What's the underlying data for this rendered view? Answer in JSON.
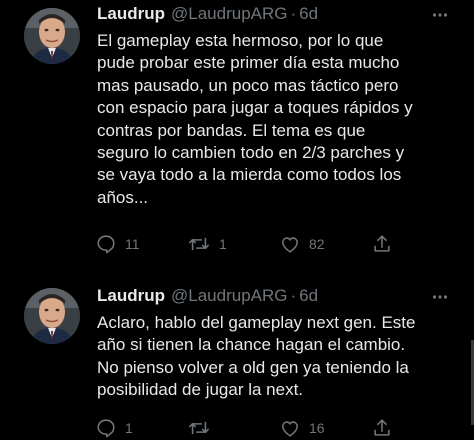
{
  "tweets": [
    {
      "author": {
        "name": "Laudrup",
        "handle": "@LaudrupARG",
        "separator": "·",
        "time": "6d"
      },
      "lines": [
        "El gameplay esta hermoso, por lo que",
        "pude probar este primer día esta mucho",
        "mas pausado, un poco mas táctico pero",
        "con espacio para jugar a toques rápidos y",
        "contras por bandas. El tema es que",
        "seguro lo cambien todo en 2/3 parches y",
        "se vaya todo a la mierda como todos los",
        "años..."
      ],
      "actions": {
        "replies": "11",
        "retweets": "1",
        "likes": "82"
      }
    },
    {
      "author": {
        "name": "Laudrup",
        "handle": "@LaudrupARG",
        "separator": "·",
        "time": "6d"
      },
      "lines": [
        "Aclaro, hablo del gameplay next gen. Este",
        "año si tienen la chance hagan el cambio.",
        "No pienso volver a old gen ya teniendo la",
        "posibilidad de jugar la next."
      ],
      "actions": {
        "replies": "1",
        "retweets": "",
        "likes": "16"
      }
    }
  ],
  "icons": {
    "reply": "reply-icon",
    "retweet": "retweet-icon",
    "like": "heart-icon",
    "share": "share-icon",
    "more": "more-icon"
  },
  "colors": {
    "background": "#000000",
    "text": "#e7e9ea",
    "secondary": "#71767b"
  }
}
